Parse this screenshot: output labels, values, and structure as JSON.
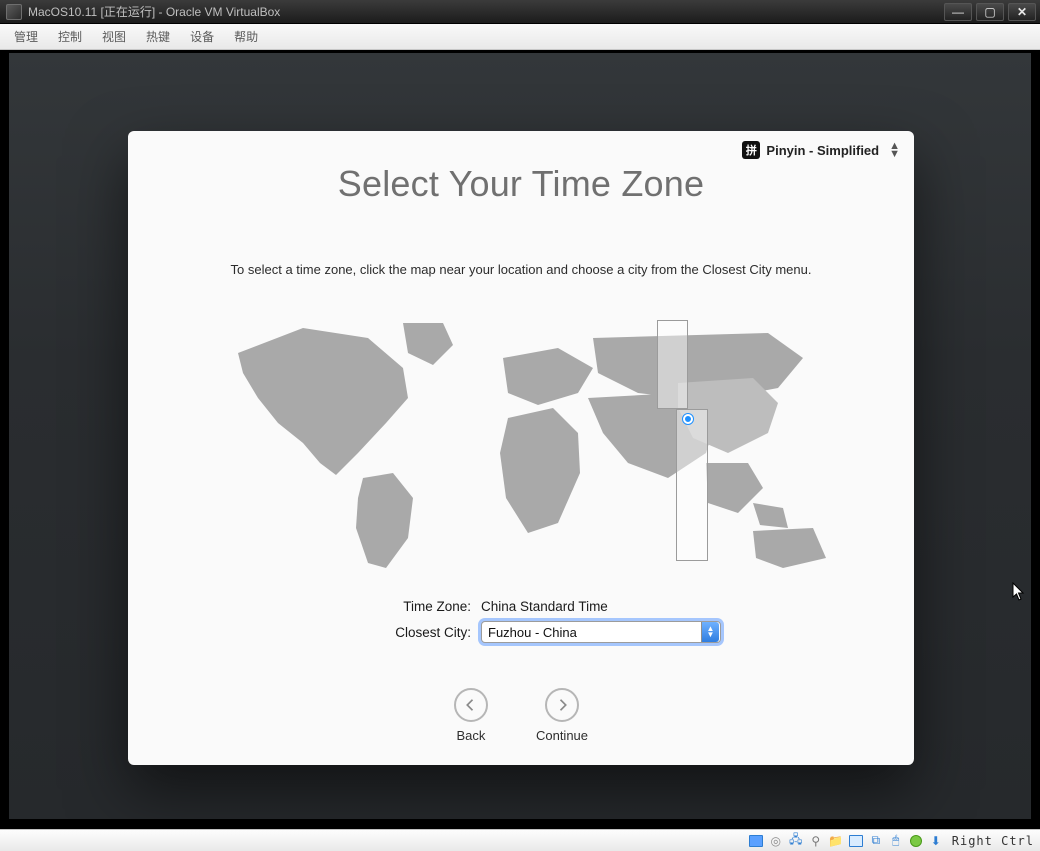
{
  "host": {
    "title": "MacOS10.11 [正在运行] - Oracle VM VirtualBox",
    "menu": [
      "管理",
      "控制",
      "视图",
      "热键",
      "设备",
      "帮助"
    ]
  },
  "ime": {
    "badge": "拼",
    "label": "Pinyin - Simplified"
  },
  "setup": {
    "title": "Select Your Time Zone",
    "instruction": "To select a time zone, click the map near your location and choose a city from the Closest City menu.",
    "time_zone_label": "Time Zone:",
    "time_zone_value": "China Standard Time",
    "closest_city_label": "Closest City:",
    "closest_city_value": "Fuzhou - China",
    "back_label": "Back",
    "continue_label": "Continue"
  },
  "status": {
    "host_key": "Right Ctrl"
  }
}
